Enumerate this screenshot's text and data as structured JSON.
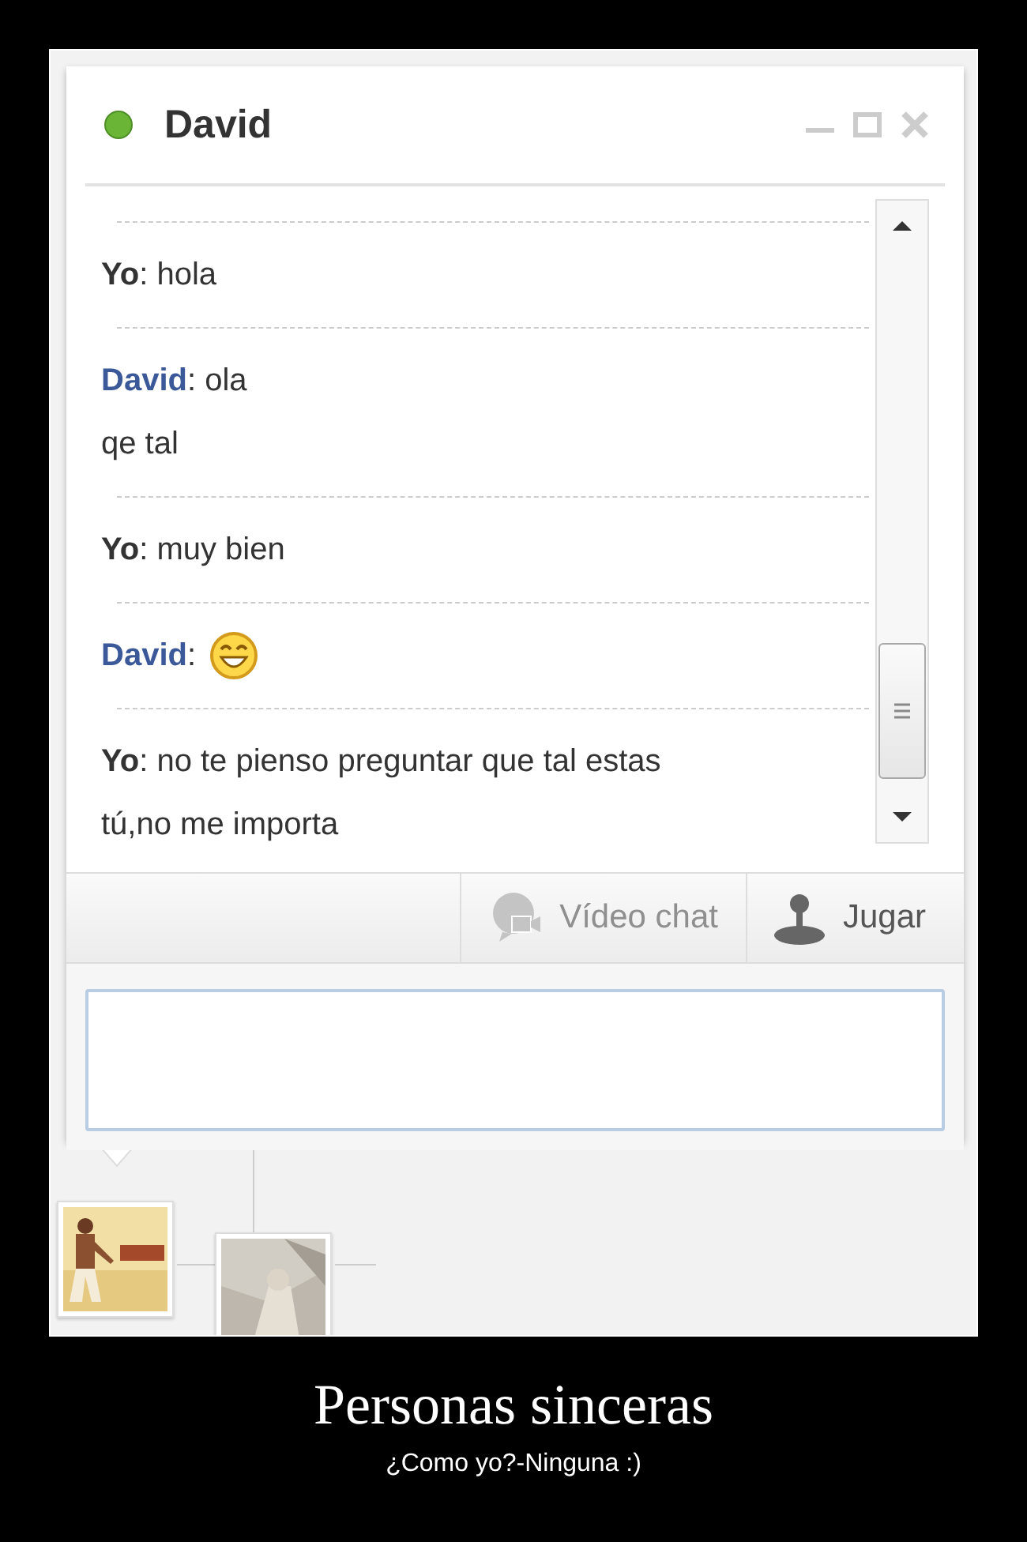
{
  "chat": {
    "contact": {
      "name": "David",
      "online": true
    },
    "messages": [
      {
        "kind": "self",
        "lines": [
          "**Yo**: hola"
        ],
        "emoticon": false
      },
      {
        "kind": "other",
        "lines": [
          "**David**: ola",
          "qe tal"
        ],
        "emoticon": false
      },
      {
        "kind": "self",
        "lines": [
          "**Yo**: muy bien"
        ],
        "emoticon": false
      },
      {
        "kind": "other",
        "lines": [
          "**David**:"
        ],
        "emoticon": true
      },
      {
        "kind": "self",
        "lines": [
          "**Yo**: no te pienso preguntar que tal estas",
          "tú,no me importa"
        ],
        "emoticon": false
      }
    ],
    "toolbar": [
      {
        "kind": "video",
        "label": "Vídeo chat",
        "disabled": true
      },
      {
        "kind": "game",
        "label": "Jugar",
        "disabled": false
      }
    ]
  },
  "caption": {
    "title": "Personas sinceras",
    "subtitle": "¿Como yo?-Ninguna :)"
  }
}
